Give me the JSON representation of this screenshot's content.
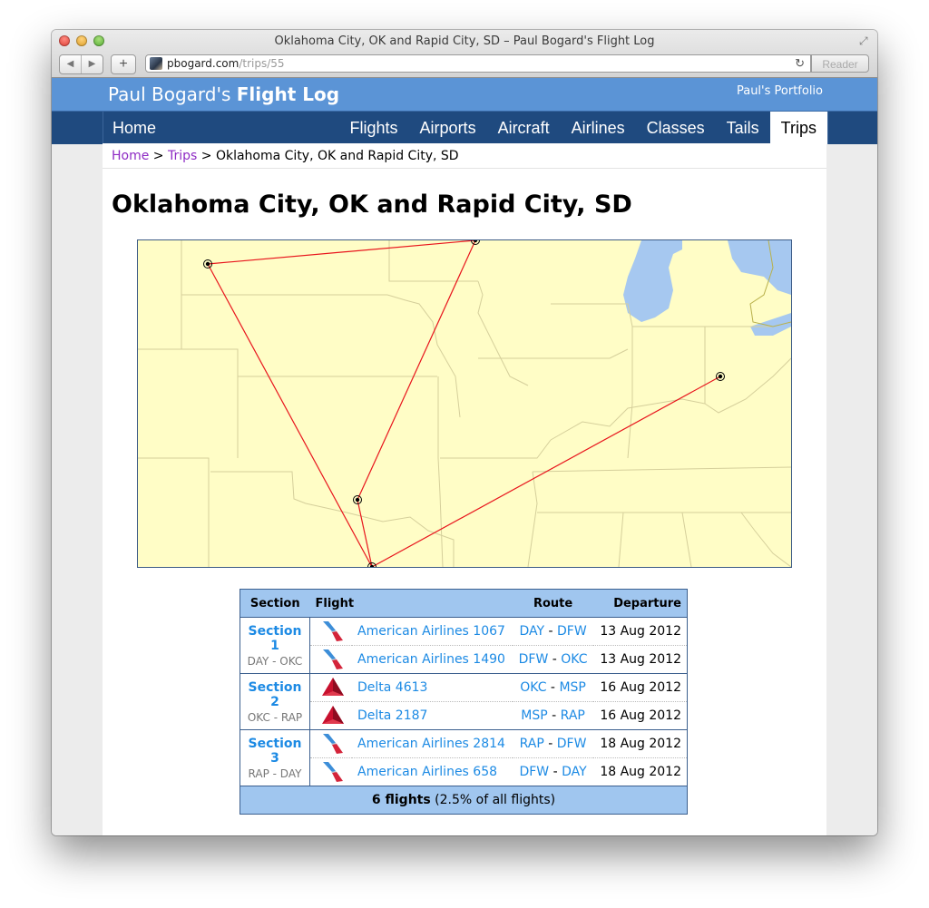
{
  "browser": {
    "window_title": "Oklahoma City, OK and Rapid City, SD – Paul Bogard's Flight Log",
    "url_domain": "pbogard.com",
    "url_path": "/trips/55",
    "reader_label": "Reader"
  },
  "site": {
    "title_light": "Paul Bogard's",
    "title_bold": "Flight Log",
    "portfolio_link": "Paul's Portfolio",
    "colors": {
      "header": "#5b94d6",
      "nav": "#1f4a7f",
      "link": "#1c8ae4",
      "visited": "#8e2bc4",
      "route_line": "#e8141c",
      "map_land": "#fffdc6",
      "map_water": "#a6c8f0"
    }
  },
  "nav": {
    "home": "Home",
    "items": [
      {
        "label": "Flights",
        "active": false
      },
      {
        "label": "Airports",
        "active": false
      },
      {
        "label": "Aircraft",
        "active": false
      },
      {
        "label": "Airlines",
        "active": false
      },
      {
        "label": "Classes",
        "active": false
      },
      {
        "label": "Tails",
        "active": false
      },
      {
        "label": "Trips",
        "active": true
      }
    ]
  },
  "breadcrumb": {
    "home": "Home",
    "sep1": " > ",
    "trips": "Trips",
    "sep2": " > ",
    "current": "Oklahoma City, OK and Rapid City, SD"
  },
  "page": {
    "title": "Oklahoma City, OK and Rapid City, SD"
  },
  "map": {
    "airports": [
      "RAP",
      "MSP",
      "OKC",
      "DFW",
      "DAY"
    ],
    "routes": [
      [
        "DAY",
        "DFW"
      ],
      [
        "DFW",
        "OKC"
      ],
      [
        "OKC",
        "MSP"
      ],
      [
        "MSP",
        "RAP"
      ],
      [
        "RAP",
        "DFW"
      ]
    ]
  },
  "table": {
    "headers": {
      "section": "Section",
      "flight": "Flight",
      "route": "Route",
      "departure": "Departure"
    },
    "sections": [
      {
        "label": "Section 1",
        "route": "DAY - OKC",
        "flights": [
          {
            "airline": "american",
            "flight": "American Airlines 1067",
            "from": "DAY",
            "to": "DFW",
            "date": "13 Aug 2012"
          },
          {
            "airline": "american",
            "flight": "American Airlines 1490",
            "from": "DFW",
            "to": "OKC",
            "date": "13 Aug 2012"
          }
        ]
      },
      {
        "label": "Section 2",
        "route": "OKC - RAP",
        "flights": [
          {
            "airline": "delta",
            "flight": "Delta 4613",
            "from": "OKC",
            "to": "MSP",
            "date": "16 Aug 2012"
          },
          {
            "airline": "delta",
            "flight": "Delta 2187",
            "from": "MSP",
            "to": "RAP",
            "date": "16 Aug 2012"
          }
        ]
      },
      {
        "label": "Section 3",
        "route": "RAP - DAY",
        "flights": [
          {
            "airline": "american",
            "flight": "American Airlines 2814",
            "from": "RAP",
            "to": "DFW",
            "date": "18 Aug 2012"
          },
          {
            "airline": "american",
            "flight": "American Airlines 658",
            "from": "DFW",
            "to": "DAY",
            "date": "18 Aug 2012"
          }
        ]
      }
    ],
    "footer": {
      "count_bold": "6 flights",
      "count_rest": " (2.5% of all flights)"
    },
    "route_sep": " - "
  }
}
